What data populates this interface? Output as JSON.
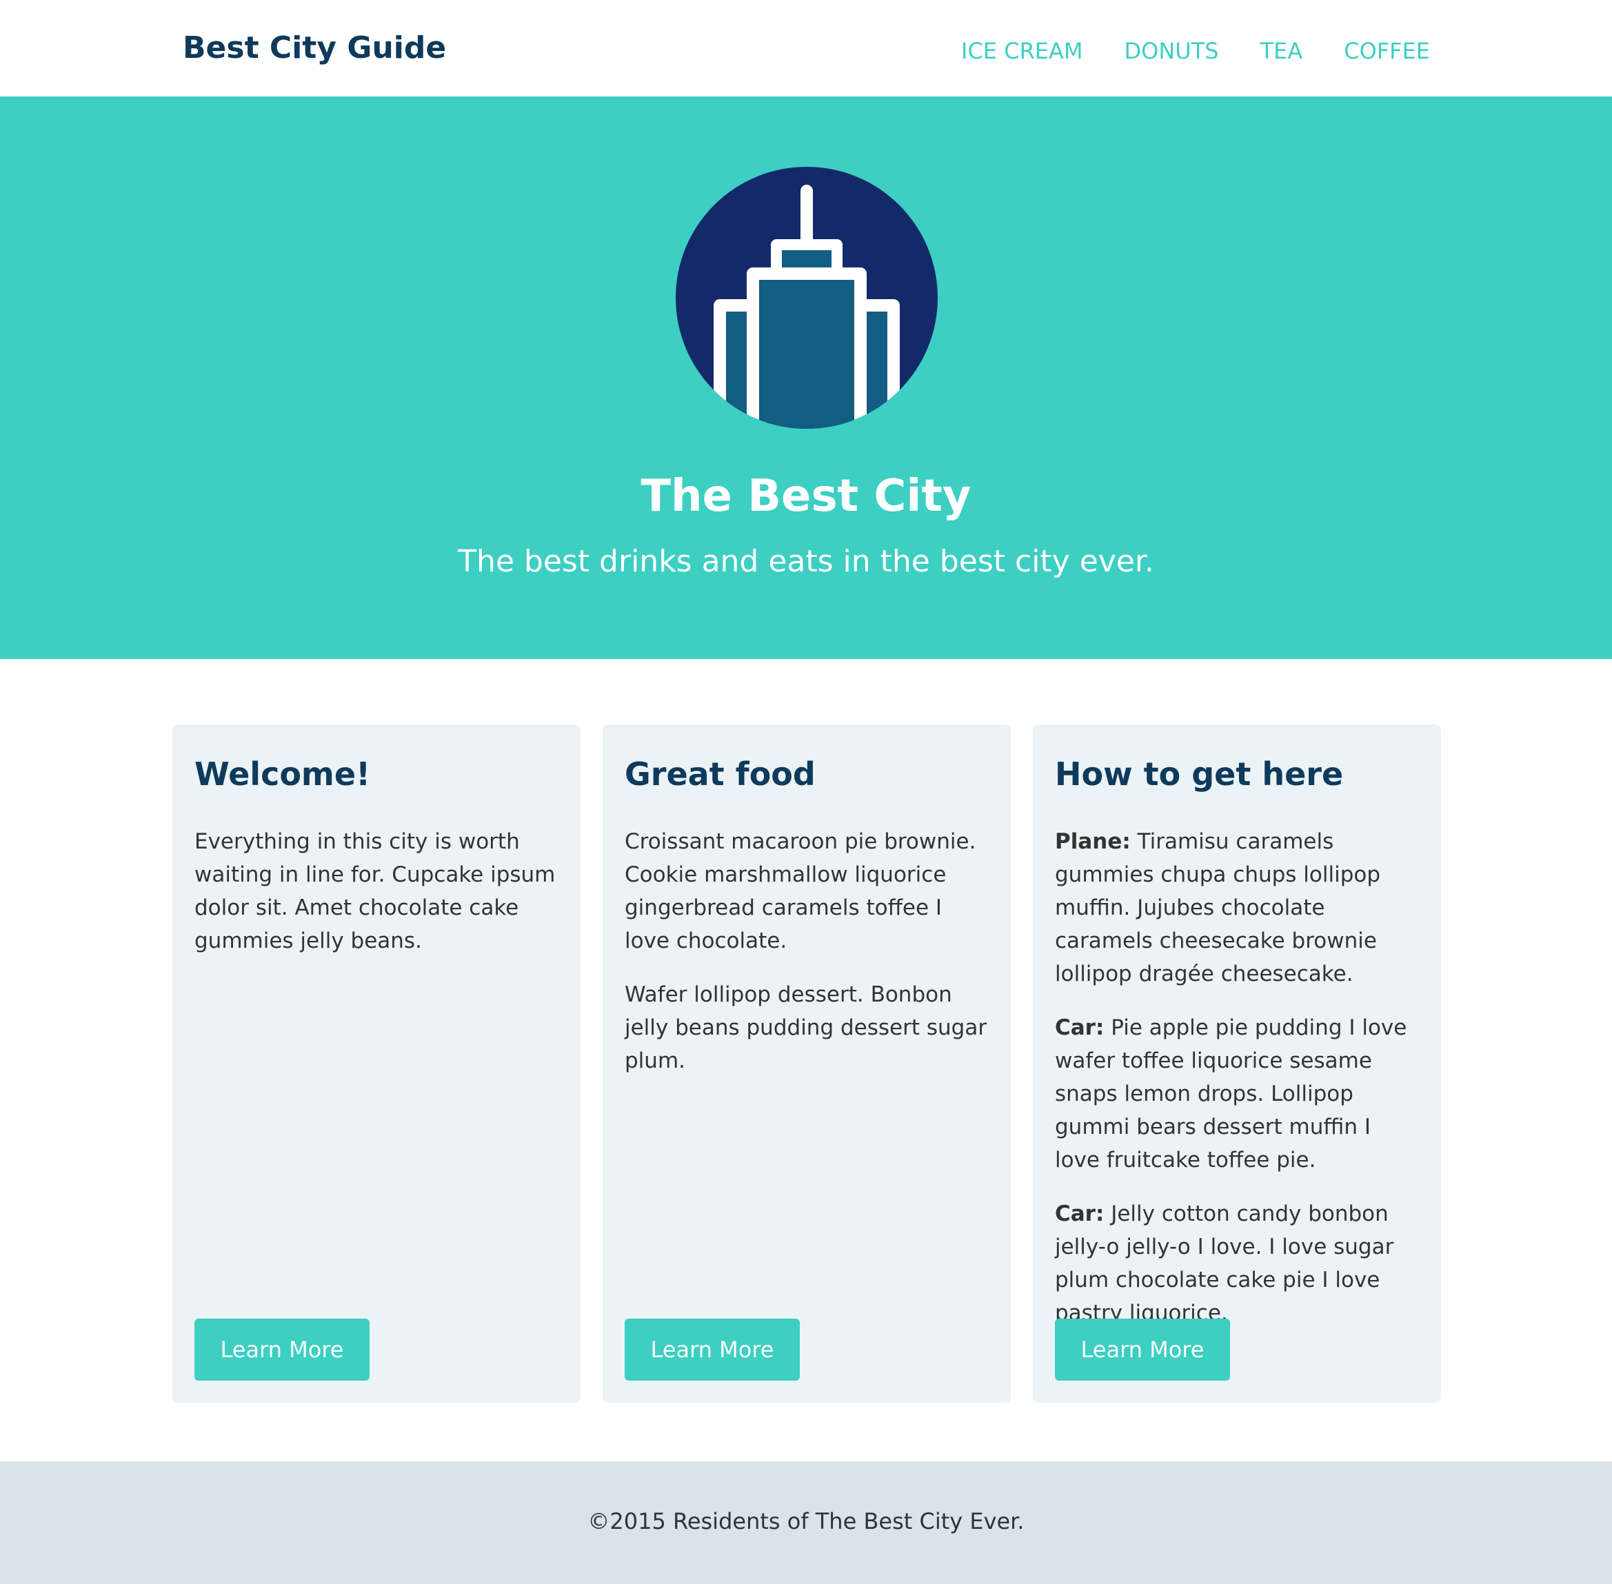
{
  "header": {
    "brand": "Best City Guide",
    "nav": [
      {
        "label": "ICE CREAM"
      },
      {
        "label": "DONUTS"
      },
      {
        "label": "TEA"
      },
      {
        "label": "COFFEE"
      }
    ]
  },
  "hero": {
    "logo_icon": "skyscraper-icon",
    "title": "The Best City",
    "subtitle": "The best drinks and eats in the best city ever."
  },
  "cards": [
    {
      "title": "Welcome!",
      "paragraphs": [
        {
          "lead": "",
          "text": "Everything in this city is worth waiting in line for. Cupcake ipsum dolor sit. Amet chocolate cake gummies jelly beans."
        }
      ],
      "button": "Learn More"
    },
    {
      "title": "Great food",
      "paragraphs": [
        {
          "lead": "",
          "text": "Croissant macaroon pie brownie. Cookie marshmallow liquorice gingerbread caramels toffee I love chocolate."
        },
        {
          "lead": "",
          "text": "Wafer lollipop dessert. Bonbon jelly beans pudding dessert sugar plum."
        }
      ],
      "button": "Learn More"
    },
    {
      "title": "How to get here",
      "paragraphs": [
        {
          "lead": "Plane:",
          "text": " Tiramisu caramels gummies chupa chups lollipop muffin. Jujubes chocolate caramels cheesecake brownie lollipop dragée cheesecake."
        },
        {
          "lead": "Car:",
          "text": " Pie apple pie pudding I love wafer toffee liquorice sesame snaps lemon drops. Lollipop gummi bears dessert muffin I love fruitcake toffee pie."
        },
        {
          "lead": "Car:",
          "text": " Jelly cotton candy bonbon jelly-o jelly-o I love. I love sugar plum chocolate cake pie I love pastry liquorice."
        }
      ],
      "button": "Learn More"
    }
  ],
  "footer": {
    "text": "©2015 Residents of The Best City Ever."
  },
  "colors": {
    "accent": "#3ccfc2",
    "navy": "#0e3a5c",
    "logo_circle": "#14296a",
    "building_fill": "#135c82",
    "card_bg": "#ecf3f6",
    "footer_bg": "#d9e3e9"
  }
}
